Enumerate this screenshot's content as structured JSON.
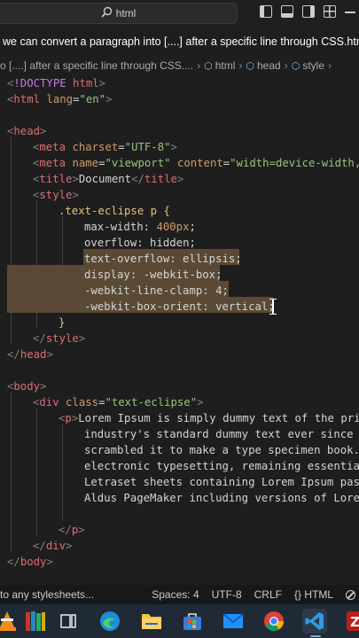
{
  "titlebar": {
    "search_text": "html"
  },
  "tab": {
    "title": "we can convert a paragraph into [....] after a specific line through CSS.html"
  },
  "breadcrumb": {
    "file": "o [....] after a specific line through CSS....",
    "items": [
      "html",
      "head",
      "style"
    ]
  },
  "code": {
    "l1": "<!DOCTYPE html>",
    "l2_tag": "html",
    "l2_attr": "lang",
    "l2_val": "\"en\"",
    "l4_tag": "head",
    "l5_attr1": "charset",
    "l5_val1": "\"UTF-8\"",
    "l6_attr1": "name",
    "l6_val1": "\"viewport\"",
    "l6_attr2": "content",
    "l6_val2": "\"width=device-width, ",
    "l7_text": "Document",
    "l8_tag": "style",
    "l9_selector": ".text-eclipse p",
    "l10_prop": "max-width",
    "l10_val": "400px",
    "l11_prop": "overflow",
    "l11_val": "hidden",
    "l12": "text-overflow: ellipsis;",
    "l13": "display: -webkit-box;",
    "l14": "-webkit-line-clamp: 4;",
    "l15": "-webkit-box-orient: vertical;",
    "l19_tag": "body",
    "l20_tag": "div",
    "l20_attr": "class",
    "l20_val": "\"text-eclipse\"",
    "l21_text": "Lorem Ipsum is simply dummy text of the prin",
    "l22_text": "industry's standard dummy text ever since th",
    "l23_text": "scrambled it to make a type specimen book. I",
    "l24_text": "electronic typesetting, remaining essentiall",
    "l25_text": "Letraset sheets containing Lorem Ipsum passa",
    "l26_text": "Aldus PageMaker including versions of Lorem"
  },
  "statusbar": {
    "left_text": "to any stylesheets...",
    "spaces": "Spaces: 4",
    "encoding": "UTF-8",
    "eol": "CRLF",
    "language": "HTML"
  },
  "taskbar": {
    "icons": [
      "vlc-icon",
      "books-icon",
      "task-view-icon",
      "edge-icon",
      "file-explorer-icon",
      "store-icon",
      "mail-icon",
      "chrome-icon",
      "vscode-icon",
      "filezilla-icon"
    ]
  },
  "colors": {
    "editor_bg": "#1e1e1e",
    "selection": "#5a4a35",
    "tag": "#e06c75",
    "string": "#98c379",
    "attribute": "#d19a66",
    "selector": "#e5c07b"
  }
}
